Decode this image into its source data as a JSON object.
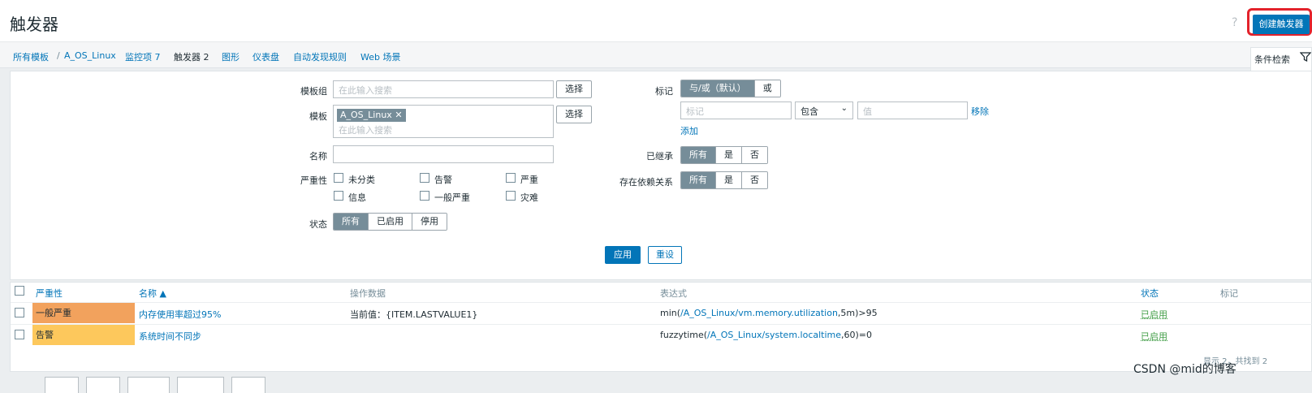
{
  "header": {
    "title": "触发器",
    "help_icon": "?",
    "create_button": "创建触发器"
  },
  "breadcrumb": {
    "items": [
      "所有模板",
      "A_OS_Linux",
      "监控项 7",
      "触发器 2",
      "图形",
      "仪表盘",
      "自动发现规则",
      "Web 场景"
    ],
    "separator": "/"
  },
  "filter_tab": {
    "label": "条件检索",
    "icon": "filter-icon"
  },
  "filter": {
    "template_group": {
      "label": "模板组",
      "placeholder": "在此输入搜索",
      "select": "选择"
    },
    "template": {
      "label": "模板",
      "tag": "A_OS_Linux",
      "tag_close": "✕",
      "placeholder": "在此输入搜索",
      "select": "选择"
    },
    "name": {
      "label": "名称",
      "value": ""
    },
    "severity": {
      "label": "严重性",
      "options": [
        "未分类",
        "告警",
        "严重",
        "信息",
        "一般严重",
        "灾难"
      ]
    },
    "status": {
      "label": "状态",
      "options": [
        "所有",
        "已启用",
        "停用"
      ],
      "selected": "所有"
    },
    "tags": {
      "label": "标记",
      "mode_options": [
        "与/或（默认）",
        "或"
      ],
      "tag_placeholder": "标记",
      "operator": "包含",
      "value_placeholder": "值",
      "remove": "移除",
      "add": "添加"
    },
    "inherited": {
      "label": "已继承",
      "options": [
        "所有",
        "是",
        "否"
      ]
    },
    "dependencies": {
      "label": "存在依赖关系",
      "options": [
        "所有",
        "是",
        "否"
      ]
    },
    "apply": "应用",
    "reset": "重设"
  },
  "table": {
    "headers": {
      "severity": "严重性",
      "name": "名称 ▲",
      "operational_data": "操作数据",
      "expression": "表达式",
      "status": "状态",
      "tags": "标记"
    },
    "rows": [
      {
        "severity": "一般严重",
        "severity_color": "#f2a25d",
        "name": "内存使用率超过95%",
        "op_data": "当前值：{ITEM.LASTVALUE1}",
        "expr_fn": "min(",
        "expr_item": "/A_OS_Linux/vm.memory.utilization",
        "expr_tail": ",5m)>95",
        "status": "已启用"
      },
      {
        "severity": "告警",
        "severity_color": "#fdc85c",
        "name": "系统时间不同步",
        "op_data": "",
        "expr_fn": "fuzzytime(",
        "expr_item": "/A_OS_Linux/system.localtime",
        "expr_tail": ",60)=0",
        "status": "已启用"
      }
    ],
    "shown": "显示 2，共找到 2"
  },
  "watermark": "CSDN @mid的博客",
  "colors": {
    "accent": "#0275b8",
    "enabled": "#429e47",
    "highlight": "#e3222b"
  }
}
